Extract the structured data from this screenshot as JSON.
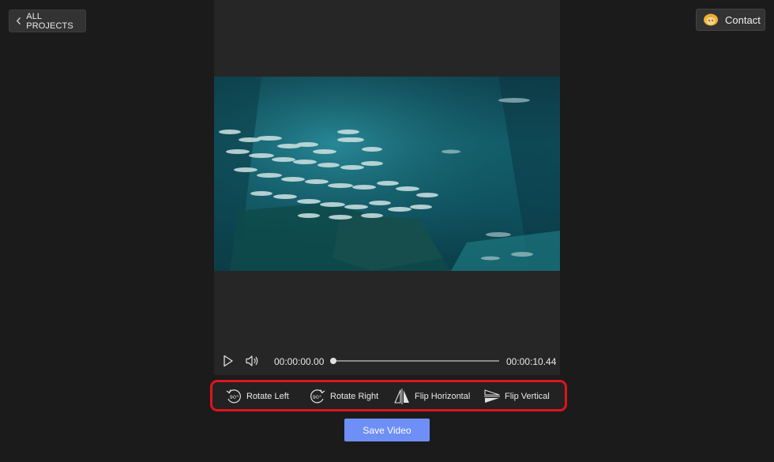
{
  "header": {
    "back_label": "ALL PROJECTS",
    "contact_label": "Contact"
  },
  "player": {
    "current_time": "00:00:00.00",
    "total_time": "00:00:10.44",
    "progress": 0
  },
  "toolbar": {
    "items": [
      {
        "label": "Rotate Left",
        "icon": "rotate-left-icon"
      },
      {
        "label": "Rotate Right",
        "icon": "rotate-right-icon"
      },
      {
        "label": "Flip Horizontal",
        "icon": "flip-horizontal-icon"
      },
      {
        "label": "Flip Vertical",
        "icon": "flip-vertical-icon"
      }
    ],
    "highlight_color": "#e0141c"
  },
  "save_label": "Save Video",
  "colors": {
    "accent": "#6e8ff5",
    "background": "#1b1b1b",
    "panel": "#262626"
  }
}
